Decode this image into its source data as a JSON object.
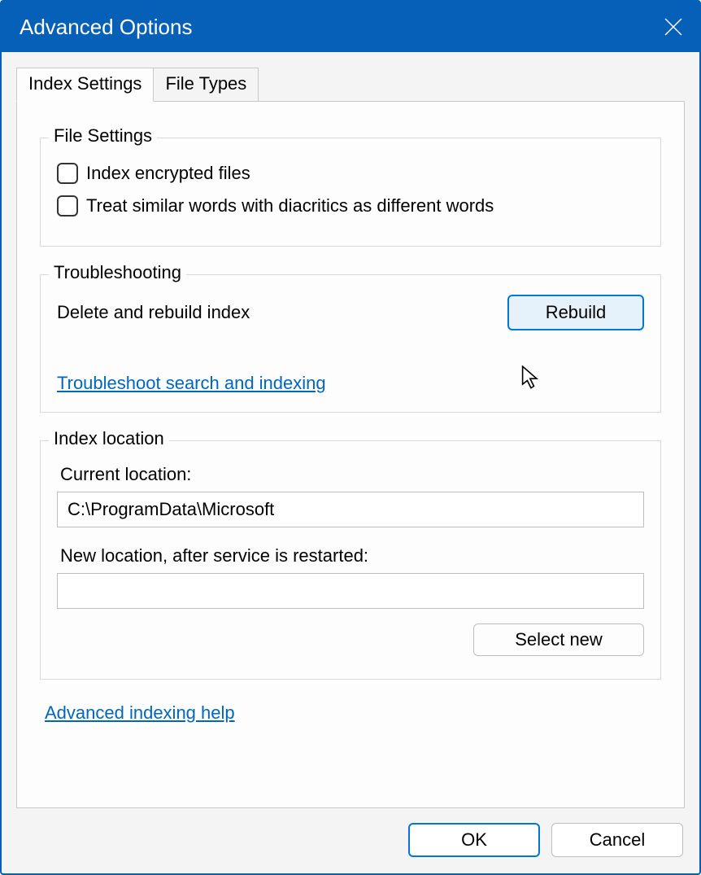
{
  "window": {
    "title": "Advanced Options"
  },
  "tabs": {
    "index_settings": "Index Settings",
    "file_types": "File Types"
  },
  "file_settings": {
    "legend": "File Settings",
    "encrypted": "Index encrypted files",
    "diacritics": "Treat similar words with diacritics as different words"
  },
  "troubleshooting": {
    "legend": "Troubleshooting",
    "delete_rebuild": "Delete and rebuild index",
    "rebuild_btn": "Rebuild",
    "troubleshoot_link": "Troubleshoot search and indexing"
  },
  "index_location": {
    "legend": "Index location",
    "current_label": "Current location:",
    "current_value": "C:\\ProgramData\\Microsoft",
    "new_label": "New location, after service is restarted:",
    "new_value": "",
    "select_new_btn": "Select new"
  },
  "help_link": "Advanced indexing help",
  "buttons": {
    "ok": "OK",
    "cancel": "Cancel"
  }
}
